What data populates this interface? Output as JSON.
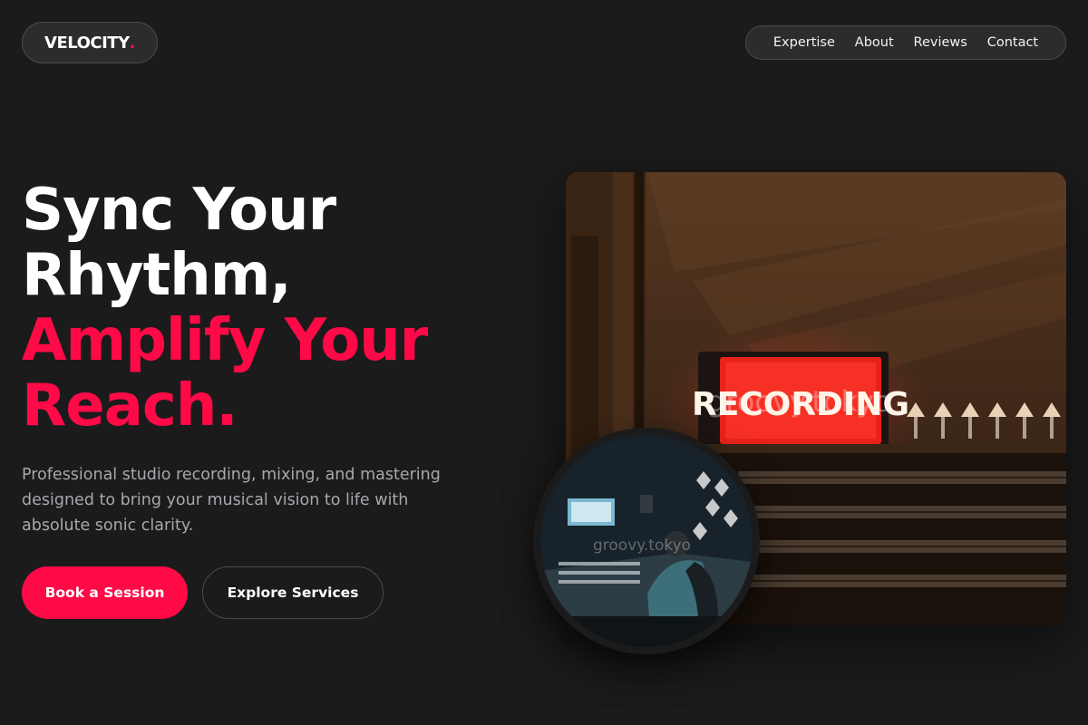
{
  "header": {
    "logo_text": "VELOCITY",
    "logo_dot": ".",
    "nav": [
      "Expertise",
      "About",
      "Reviews",
      "Contact"
    ]
  },
  "hero": {
    "headline_white": [
      "Sync Your",
      "Rhythm,"
    ],
    "headline_red": [
      "Amplify Your",
      "Reach."
    ],
    "subtext": "Professional studio recording, mixing, and mastering designed to bring your musical vision to life with absolute sonic clarity.",
    "primary_cta": "Book a Session",
    "secondary_cta": "Explore Services"
  },
  "images": {
    "main_sign_text": "RECORDING",
    "main_watermark": "groovy.tokyo",
    "circle_watermark": "groovy.tokyo"
  },
  "colors": {
    "background": "#1b1b1c",
    "accent": "#ff0a47",
    "pill": "#2c2c2e",
    "muted_text": "#a7a7ad"
  }
}
